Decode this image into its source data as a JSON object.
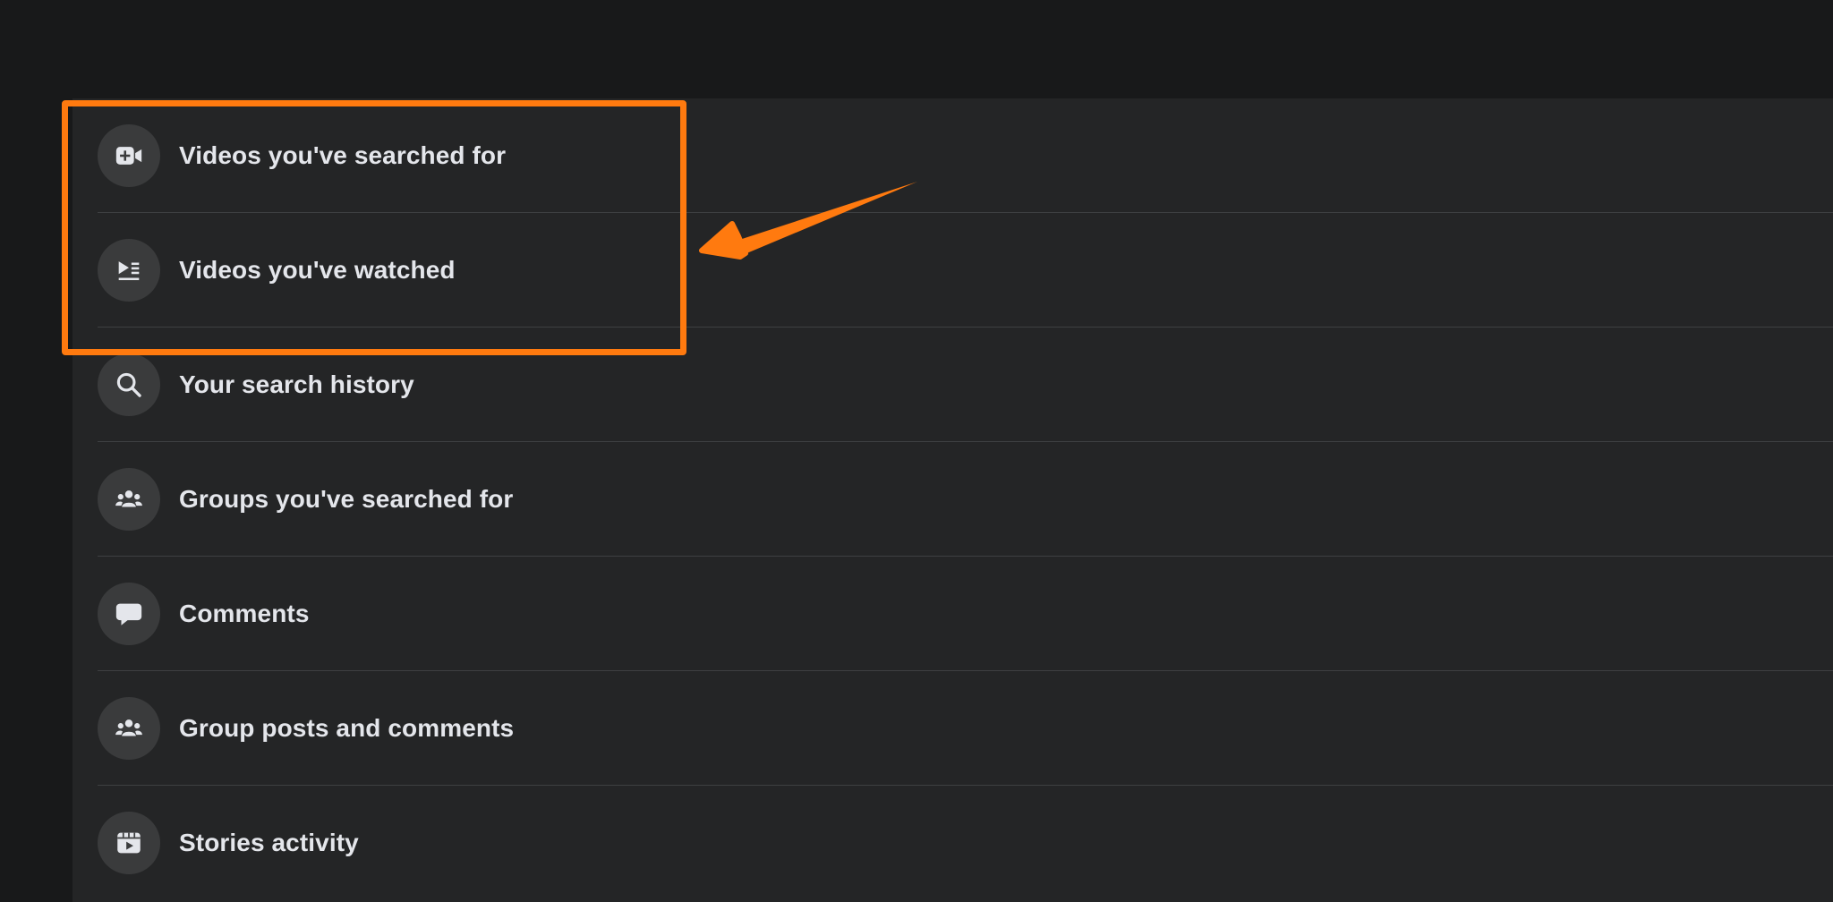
{
  "colors": {
    "page_background": "#18191a",
    "panel_background": "#242526",
    "icon_background": "#3a3b3c",
    "text": "#e4e6eb",
    "divider": "#3e4042",
    "annotation": "#ff7a0f"
  },
  "activity_items": [
    {
      "label": "Videos you've searched for",
      "icon": "video-plus-icon"
    },
    {
      "label": "Videos you've watched",
      "icon": "play-list-icon"
    },
    {
      "label": "Your search history",
      "icon": "search-icon"
    },
    {
      "label": "Groups you've searched for",
      "icon": "group-icon"
    },
    {
      "label": "Comments",
      "icon": "comment-bubble-icon"
    },
    {
      "label": "Group posts and comments",
      "icon": "group-icon"
    },
    {
      "label": "Stories activity",
      "icon": "stories-clapper-icon"
    }
  ],
  "annotation": {
    "type": "highlight-box-with-arrow",
    "highlighted_items": [
      "Videos you've searched for",
      "Videos you've watched"
    ]
  }
}
